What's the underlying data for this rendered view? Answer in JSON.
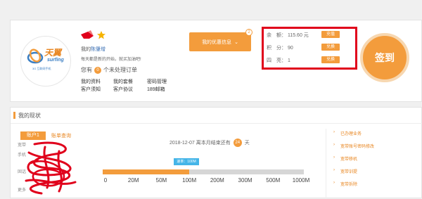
{
  "brand": {
    "logo_cn": "天翼",
    "logo_en": "surfing",
    "logo_sub": "3G 互联网手机",
    "colors": {
      "accent": "#f39c3c",
      "highlight": "#e0001b",
      "link": "#3a6fb4",
      "progress_tip": "#45b5e8"
    }
  },
  "profile": {
    "greeting": "我的",
    "username": "陈肇增",
    "motto": "每天都是新的开始，就买加油吧!",
    "orders_prefix": "您有",
    "orders_count": "0",
    "orders_suffix": "个未处理订单",
    "links": [
      "我的资料",
      "我的套餐",
      "密码管理",
      "客户须知",
      "客户协议",
      "189邮箱"
    ]
  },
  "coupon": {
    "label": "我的优惠信息",
    "count": "2"
  },
  "balance": {
    "rows": [
      {
        "label": "余　额：",
        "value": "115.60 元",
        "button": "充值"
      },
      {
        "label": "积　分：",
        "value": "90",
        "button": "兑换"
      },
      {
        "label": "四　亮：",
        "value": "1",
        "button": "兑换"
      }
    ]
  },
  "signin": {
    "label": "签到"
  },
  "status": {
    "title": "我的现状",
    "tabs": {
      "active": "账户1",
      "inactive": "账单查询"
    },
    "side_labels": [
      "宽带",
      "手机",
      "固话",
      "更多"
    ],
    "date": "2018-12-07",
    "days_text_prefix": "离本月结束还有",
    "days": "24",
    "days_unit": "天",
    "speed_label": "速率：100M",
    "speed_value_mbps": 100,
    "speed_max_mbps": 1000,
    "tick_labels": [
      "0",
      "20M",
      "50M",
      "100M",
      "200M",
      "300M",
      "500M",
      "1000M"
    ]
  },
  "business": {
    "items": [
      "已办理业务",
      "宽带账号密码修改",
      "宽带移机",
      "宽带训提",
      "宽带拆除"
    ]
  }
}
